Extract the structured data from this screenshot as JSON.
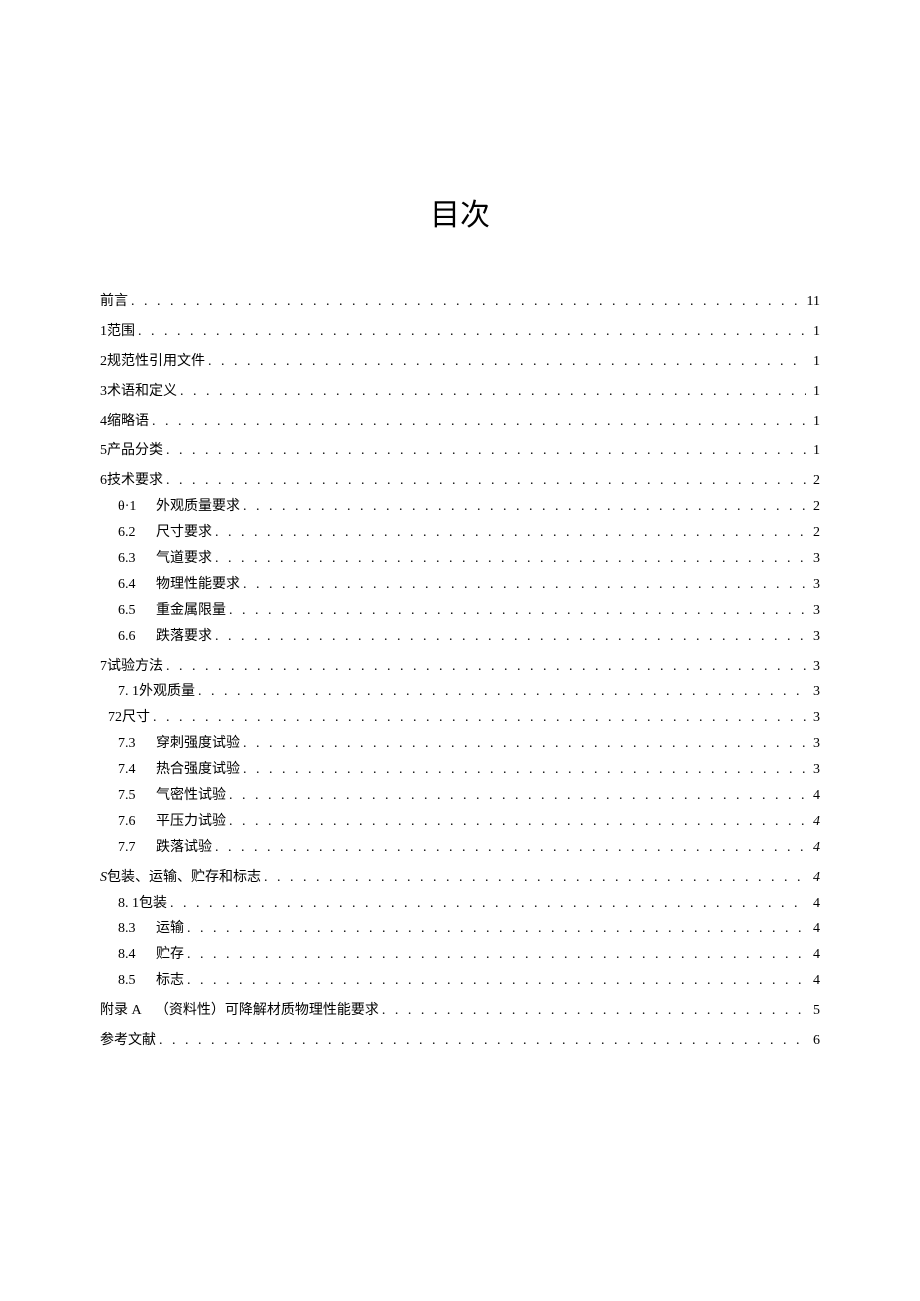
{
  "title": "目次",
  "entries": [
    {
      "level": 1,
      "gap": false,
      "num": "",
      "numFixed": false,
      "text": "前言",
      "page": "11",
      "italicPage": false
    },
    {
      "level": 1,
      "gap": true,
      "num": "1 ",
      "numFixed": false,
      "text": "范围",
      "page": "1",
      "italicPage": false
    },
    {
      "level": 1,
      "gap": true,
      "num": "2 ",
      "numFixed": false,
      "text": "规范性引用文件",
      "page": "1",
      "italicPage": false
    },
    {
      "level": 1,
      "gap": true,
      "num": "3 ",
      "numFixed": false,
      "text": "术语和定义",
      "page": "1",
      "italicPage": false
    },
    {
      "level": 1,
      "gap": true,
      "num": "4 ",
      "numFixed": false,
      "text": "缩略语",
      "page": "1",
      "italicPage": false
    },
    {
      "level": 1,
      "gap": true,
      "num": "5 ",
      "numFixed": false,
      "text": "产品分类",
      "page": "1",
      "italicPage": false
    },
    {
      "level": 1,
      "gap": true,
      "num": "6 ",
      "numFixed": false,
      "text": "技术要求",
      "page": "2",
      "italicPage": false
    },
    {
      "level": 2,
      "gap": false,
      "num": "θ·1",
      "numFixed": true,
      "text": "外观质量要求",
      "page": "2",
      "italicPage": false
    },
    {
      "level": 2,
      "gap": false,
      "num": "6.2",
      "numFixed": true,
      "text": "尺寸要求",
      "page": "2",
      "italicPage": false
    },
    {
      "level": 2,
      "gap": false,
      "num": "6.3",
      "numFixed": true,
      "text": "气道要求",
      "page": "3",
      "italicPage": false
    },
    {
      "level": 2,
      "gap": false,
      "num": "6.4",
      "numFixed": true,
      "text": "物理性能要求",
      "page": "3",
      "italicPage": false
    },
    {
      "level": 2,
      "gap": false,
      "num": "6.5",
      "numFixed": true,
      "text": "重金属限量",
      "page": "3",
      "italicPage": false
    },
    {
      "level": 2,
      "gap": false,
      "num": "6.6",
      "numFixed": true,
      "text": "跌落要求",
      "page": "3",
      "italicPage": false
    },
    {
      "level": 1,
      "gap": true,
      "num": "7 ",
      "numFixed": false,
      "text": "试验方法",
      "page": "3",
      "italicPage": false
    },
    {
      "level": 2,
      "gap": false,
      "num": "7.  1 ",
      "numFixed": false,
      "text": "外观质量",
      "page": "3",
      "italicPage": false
    },
    {
      "level": 2,
      "gap": false,
      "num": "72 ",
      "numFixed": false,
      "text": "尺寸",
      "page": "3",
      "italicPage": false,
      "indentOverride": 8
    },
    {
      "level": 2,
      "gap": false,
      "num": "7.3",
      "numFixed": true,
      "text": "穿刺强度试验",
      "page": "3",
      "italicPage": false
    },
    {
      "level": 2,
      "gap": false,
      "num": "7.4",
      "numFixed": true,
      "text": "热合强度试验",
      "page": "3",
      "italicPage": false
    },
    {
      "level": 2,
      "gap": false,
      "num": "7.5",
      "numFixed": true,
      "text": "气密性试验",
      "page": "4",
      "italicPage": false
    },
    {
      "level": 2,
      "gap": false,
      "num": "7.6",
      "numFixed": true,
      "text": "平压力试验",
      "page": "4",
      "italicPage": true
    },
    {
      "level": 2,
      "gap": false,
      "num": "7.7",
      "numFixed": true,
      "text": "跌落试验",
      "page": "4",
      "italicPage": true
    },
    {
      "level": 1,
      "gap": true,
      "num": "",
      "numFixed": false,
      "prefixItalic": "S",
      "text": " 包装、运输、贮存和标志 ",
      "page": "4",
      "italicPage": true
    },
    {
      "level": 2,
      "gap": false,
      "num": "8.  1 ",
      "numFixed": false,
      "text": "包装",
      "page": "4",
      "italicPage": false
    },
    {
      "level": 2,
      "gap": false,
      "num": "8.3",
      "numFixed": true,
      "text": "运输",
      "page": "4",
      "italicPage": false
    },
    {
      "level": 2,
      "gap": false,
      "num": "8.4",
      "numFixed": true,
      "text": "贮存",
      "page": "4",
      "italicPage": false
    },
    {
      "level": 2,
      "gap": false,
      "num": "8.5",
      "numFixed": true,
      "text": "标志",
      "page": "4",
      "italicPage": false
    },
    {
      "level": 1,
      "gap": true,
      "num": "附录 A　",
      "numFixed": false,
      "text": "（资料性）可降解材质物理性能要求 ",
      "page": "5",
      "italicPage": false
    },
    {
      "level": 1,
      "gap": true,
      "num": "",
      "numFixed": false,
      "text": "参考文献",
      "page": "6",
      "italicPage": false
    }
  ]
}
